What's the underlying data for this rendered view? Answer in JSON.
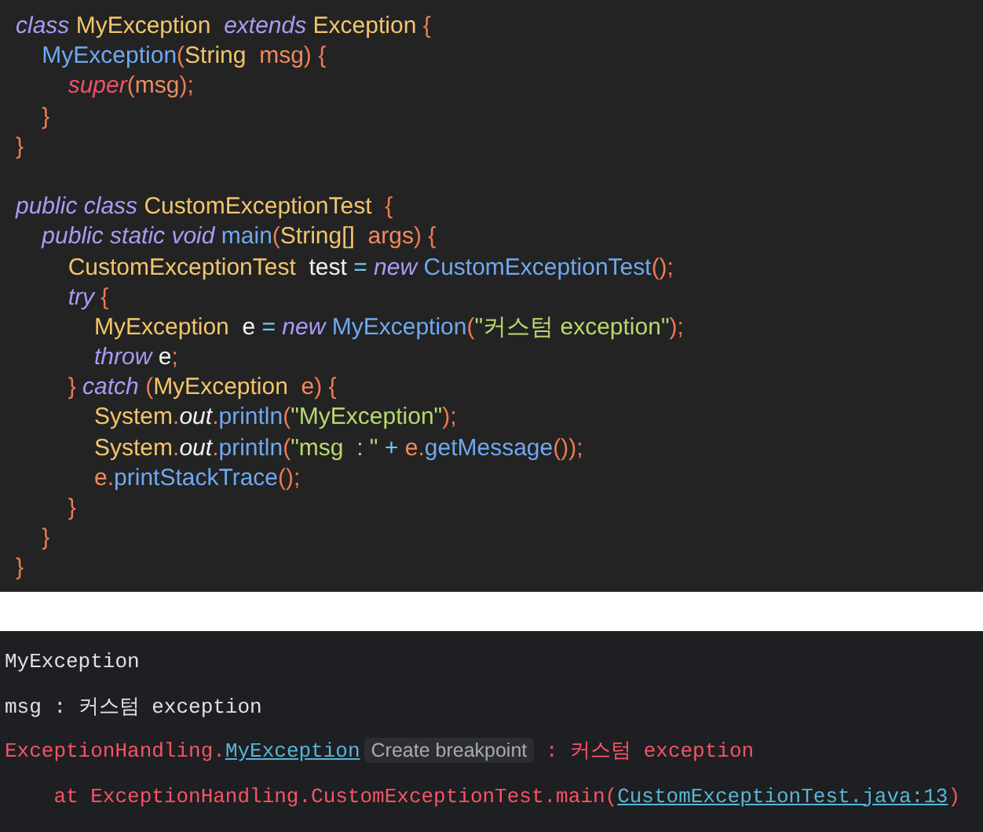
{
  "editor": {
    "blocks": [
      {
        "lines": [
          {
            "tokens": [
              {
                "text": "class ",
                "kind": "keyword"
              },
              {
                "text": "MyException  ",
                "kind": "type"
              },
              {
                "text": "extends ",
                "kind": "keyword"
              },
              {
                "text": "Exception ",
                "kind": "type"
              },
              {
                "text": "{",
                "kind": "punct"
              }
            ]
          },
          {
            "tokens": [
              {
                "text": "    MyException",
                "kind": "method"
              },
              {
                "text": "(",
                "kind": "punct"
              },
              {
                "text": "String  ",
                "kind": "type"
              },
              {
                "text": "msg",
                "kind": "param"
              },
              {
                "text": ") {",
                "kind": "punct"
              }
            ]
          },
          {
            "tokens": [
              {
                "text": "        super",
                "kind": "super"
              },
              {
                "text": "(",
                "kind": "punct"
              },
              {
                "text": "msg",
                "kind": "param"
              },
              {
                "text": ");",
                "kind": "punct"
              }
            ]
          },
          {
            "tokens": [
              {
                "text": "    }",
                "kind": "punct"
              }
            ]
          },
          {
            "tokens": [
              {
                "text": "}",
                "kind": "punct"
              }
            ]
          }
        ]
      },
      {
        "lines": [
          {
            "tokens": [
              {
                "text": "public ",
                "kind": "keyword"
              },
              {
                "text": "class ",
                "kind": "keyword"
              },
              {
                "text": "CustomExceptionTest  ",
                "kind": "type"
              },
              {
                "text": "{",
                "kind": "punct"
              }
            ]
          },
          {
            "tokens": [
              {
                "text": "    public ",
                "kind": "keyword"
              },
              {
                "text": "static ",
                "kind": "keyword"
              },
              {
                "text": "void ",
                "kind": "keyword"
              },
              {
                "text": "main",
                "kind": "method"
              },
              {
                "text": "(",
                "kind": "punct"
              },
              {
                "text": "String[]  ",
                "kind": "type"
              },
              {
                "text": "args",
                "kind": "param"
              },
              {
                "text": ") {",
                "kind": "punct"
              }
            ]
          },
          {
            "tokens": [
              {
                "text": "        CustomExceptionTest  ",
                "kind": "type"
              },
              {
                "text": "test ",
                "kind": "ident"
              },
              {
                "text": "= ",
                "kind": "operator"
              },
              {
                "text": "new ",
                "kind": "keyword"
              },
              {
                "text": "CustomExceptionTest",
                "kind": "method"
              },
              {
                "text": "();",
                "kind": "punct"
              }
            ]
          },
          {
            "tokens": [
              {
                "text": "        try ",
                "kind": "keyword"
              },
              {
                "text": "{",
                "kind": "punct"
              }
            ]
          },
          {
            "tokens": [
              {
                "text": "            MyException  ",
                "kind": "type"
              },
              {
                "text": "e ",
                "kind": "ident"
              },
              {
                "text": "= ",
                "kind": "operator"
              },
              {
                "text": "new ",
                "kind": "keyword"
              },
              {
                "text": "MyException",
                "kind": "method"
              },
              {
                "text": "(",
                "kind": "punct"
              },
              {
                "text": "\"커스텀 exception\"",
                "kind": "string"
              },
              {
                "text": ");",
                "kind": "punct"
              }
            ]
          },
          {
            "tokens": [
              {
                "text": "            throw ",
                "kind": "keyword"
              },
              {
                "text": "e",
                "kind": "ident"
              },
              {
                "text": ";",
                "kind": "punct"
              }
            ]
          },
          {
            "tokens": [
              {
                "text": "        } ",
                "kind": "punct"
              },
              {
                "text": "catch ",
                "kind": "keyword"
              },
              {
                "text": "(",
                "kind": "punct"
              },
              {
                "text": "MyException  ",
                "kind": "type"
              },
              {
                "text": "e",
                "kind": "param"
              },
              {
                "text": ") {",
                "kind": "punct"
              }
            ]
          },
          {
            "tokens": [
              {
                "text": "            System",
                "kind": "type"
              },
              {
                "text": ".",
                "kind": "punct"
              },
              {
                "text": "out",
                "kind": "field"
              },
              {
                "text": ".",
                "kind": "punct"
              },
              {
                "text": "println",
                "kind": "method"
              },
              {
                "text": "(",
                "kind": "punct"
              },
              {
                "text": "\"MyException\"",
                "kind": "string"
              },
              {
                "text": ");",
                "kind": "punct"
              }
            ]
          },
          {
            "tokens": [
              {
                "text": "            System",
                "kind": "type"
              },
              {
                "text": ".",
                "kind": "punct"
              },
              {
                "text": "out",
                "kind": "field"
              },
              {
                "text": ".",
                "kind": "punct"
              },
              {
                "text": "println",
                "kind": "method"
              },
              {
                "text": "(",
                "kind": "punct"
              },
              {
                "text": "\"msg  : \"",
                "kind": "string"
              },
              {
                "text": " + ",
                "kind": "operator"
              },
              {
                "text": "e",
                "kind": "param"
              },
              {
                "text": ".",
                "kind": "punct"
              },
              {
                "text": "getMessage",
                "kind": "method"
              },
              {
                "text": "());",
                "kind": "punct"
              }
            ]
          },
          {
            "tokens": [
              {
                "text": "            e",
                "kind": "param"
              },
              {
                "text": ".",
                "kind": "punct"
              },
              {
                "text": "printStackTrace",
                "kind": "method"
              },
              {
                "text": "();",
                "kind": "punct"
              }
            ]
          },
          {
            "tokens": [
              {
                "text": "        }",
                "kind": "punct"
              }
            ]
          },
          {
            "tokens": [
              {
                "text": "    }",
                "kind": "punct"
              }
            ]
          },
          {
            "tokens": [
              {
                "text": "}",
                "kind": "punct"
              }
            ]
          }
        ]
      }
    ]
  },
  "console": {
    "lines": [
      {
        "segments": [
          {
            "text": "MyException",
            "kind": "plain"
          }
        ]
      },
      {
        "segments": [
          {
            "text": "msg : 커스텀 exception",
            "kind": "plain"
          }
        ]
      },
      {
        "segments": [
          {
            "text": "ExceptionHandling.",
            "kind": "error"
          },
          {
            "text": "MyException",
            "kind": "link"
          },
          {
            "text": "Create breakpoint",
            "kind": "hint"
          },
          {
            "text": " : 커스텀 exception",
            "kind": "error"
          }
        ]
      },
      {
        "segments": [
          {
            "text": "    at ExceptionHandling.CustomExceptionTest.main(",
            "kind": "error"
          },
          {
            "text": "CustomExceptionTest.java:13",
            "kind": "link"
          },
          {
            "text": ")",
            "kind": "error"
          }
        ]
      }
    ]
  }
}
